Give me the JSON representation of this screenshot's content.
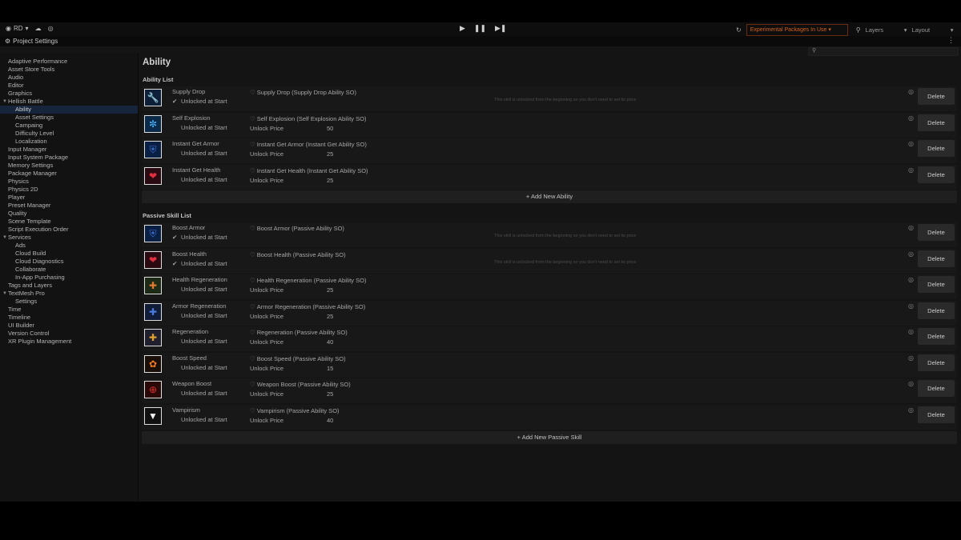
{
  "toolbar": {
    "account": "RD",
    "exp_packages": "Experimental Packages In Use",
    "layers": "Layers",
    "layout": "Layout"
  },
  "window": {
    "title": "Project Settings",
    "menu": "⋮"
  },
  "sidebar": {
    "items": [
      {
        "label": "Adaptive Performance"
      },
      {
        "label": "Asset Store Tools"
      },
      {
        "label": "Audio"
      },
      {
        "label": "Editor"
      },
      {
        "label": "Graphics"
      },
      {
        "label": "Hellish Battle",
        "expanded": true
      },
      {
        "label": "Ability",
        "child": true,
        "selected": true
      },
      {
        "label": "Asset Settings",
        "child": true
      },
      {
        "label": "Campaing",
        "child": true
      },
      {
        "label": "Difficulty Level",
        "child": true
      },
      {
        "label": "Localization",
        "child": true
      },
      {
        "label": "Input Manager"
      },
      {
        "label": "Input System Package"
      },
      {
        "label": "Memory Settings"
      },
      {
        "label": "Package Manager"
      },
      {
        "label": "Physics"
      },
      {
        "label": "Physics 2D"
      },
      {
        "label": "Player"
      },
      {
        "label": "Preset Manager"
      },
      {
        "label": "Quality"
      },
      {
        "label": "Scene Template"
      },
      {
        "label": "Script Execution Order"
      },
      {
        "label": "Services",
        "expanded": true
      },
      {
        "label": "Ads",
        "child": true
      },
      {
        "label": "Cloud Build",
        "child": true
      },
      {
        "label": "Cloud Diagnostics",
        "child": true
      },
      {
        "label": "Collaborate",
        "child": true
      },
      {
        "label": "In-App Purchasing",
        "child": true
      },
      {
        "label": "Tags and Layers"
      },
      {
        "label": "TextMesh Pro",
        "expanded": true
      },
      {
        "label": "Settings",
        "child": true
      },
      {
        "label": "Time"
      },
      {
        "label": "Timeline"
      },
      {
        "label": "UI Builder"
      },
      {
        "label": "Version Control"
      },
      {
        "label": "XR Plugin Management"
      }
    ]
  },
  "main": {
    "title": "Ability",
    "ability_section": "Ability List",
    "passive_section": "Passive Skill List",
    "unlocked_label": "Unlocked at Start",
    "price_label": "Unlock Price",
    "delete_label": "Delete",
    "hint": "This skill is unlocked from the beginning so you don't need to set its price",
    "add_ability": "+ Add New Ability",
    "add_passive": "+ Add New Passive Skill",
    "abilities": [
      {
        "name": "Supply Drop",
        "so": "Supply Drop (Supply Drop Ability SO)",
        "checked": true,
        "icon": "supply-drop-icon"
      },
      {
        "name": "Self Explosion",
        "so": "Self Explosion (Self Explosion Ability SO)",
        "checked": false,
        "price": "50",
        "icon": "self-explosion-icon"
      },
      {
        "name": "Instant Get Armor",
        "so": "Instant Get Armor (Instant Get Ability SO)",
        "checked": false,
        "price": "25",
        "icon": "armor-shield-icon"
      },
      {
        "name": "Instant Get Health",
        "so": "Instant Get Health (Instant Get Ability SO)",
        "checked": false,
        "price": "25",
        "icon": "health-heart-icon"
      }
    ],
    "passives": [
      {
        "name": "Boost Armor",
        "so": "Boost Armor (Passive Ability SO)",
        "checked": true,
        "icon": "armor-shield-icon"
      },
      {
        "name": "Boost Health",
        "so": "Boost Health (Passive Ability SO)",
        "checked": true,
        "icon": "health-heart-icon"
      },
      {
        "name": "Health Regeneration",
        "so": "Health Regeneration (Passive Ability SO)",
        "checked": false,
        "price": "25",
        "icon": "health-regen-icon"
      },
      {
        "name": "Armor Regeneration",
        "so": "Armor Regeneration (Passive Ability SO)",
        "checked": false,
        "price": "25",
        "icon": "armor-regen-icon"
      },
      {
        "name": "Regeneration",
        "so": "Regeneration (Passive Ability SO)",
        "checked": false,
        "price": "40",
        "icon": "regeneration-icon"
      },
      {
        "name": "Boost Speed",
        "so": "Boost Speed (Passive Ability SO)",
        "checked": false,
        "price": "15",
        "icon": "speed-paw-icon"
      },
      {
        "name": "Weapon Boost",
        "so": "Weapon Boost (Passive Ability SO)",
        "checked": false,
        "price": "25",
        "icon": "weapon-crosshair-icon"
      },
      {
        "name": "Vampirism",
        "so": "Vampirism (Passive Ability SO)",
        "checked": false,
        "price": "40",
        "icon": "vampirism-fangs-icon"
      }
    ]
  }
}
